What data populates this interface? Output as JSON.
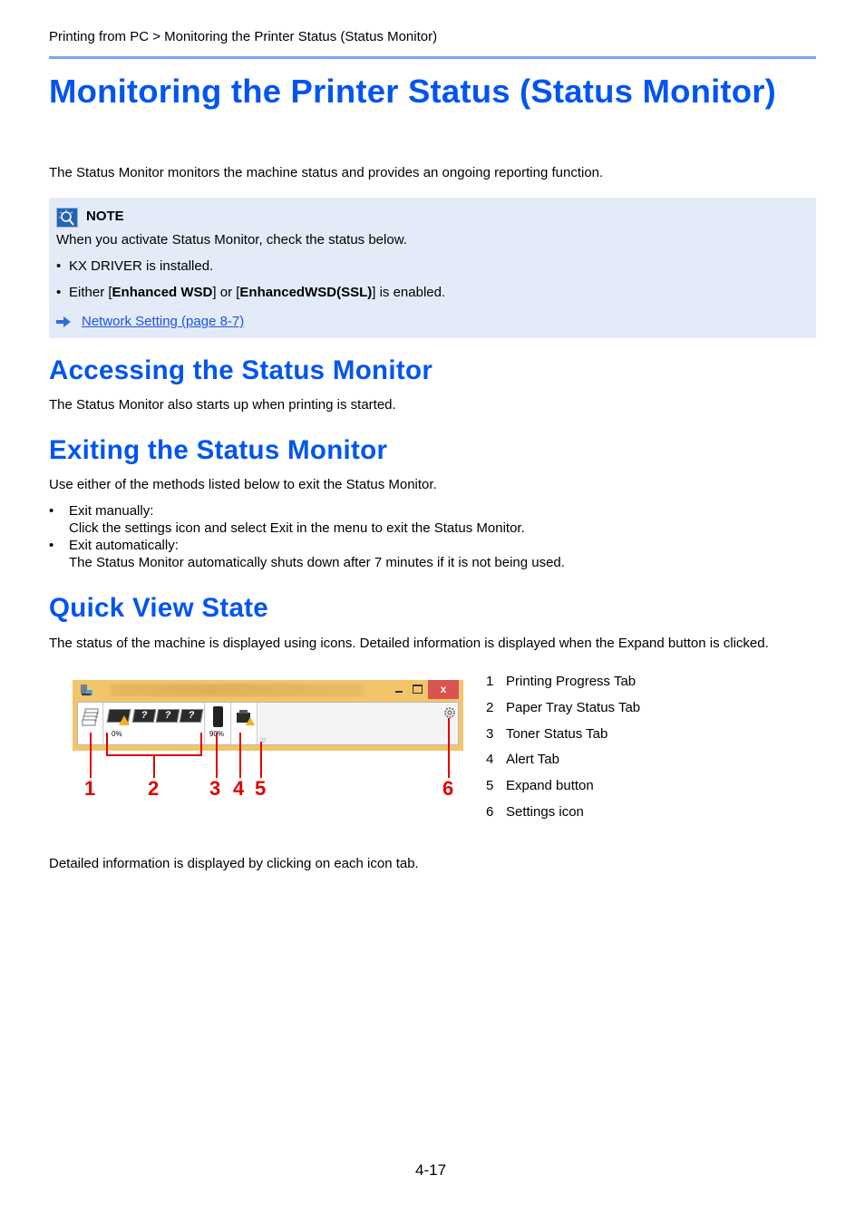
{
  "breadcrumb": "Printing from PC > Monitoring the Printer Status (Status Monitor)",
  "title": "Monitoring the Printer Status (Status Monitor)",
  "intro": "The Status Monitor monitors the machine status and provides an ongoing reporting function.",
  "note": {
    "heading": "NOTE",
    "lead": "When you activate Status Monitor, check the status below.",
    "bullet1": "KX DRIVER is installed.",
    "bullet2": {
      "pre": "Either [",
      "bold1": "Enhanced WSD",
      "mid": "] or [",
      "bold2": "EnhancedWSD(SSL)",
      "post": "] is enabled."
    },
    "link": "Network Setting (page 8-7)"
  },
  "sections": {
    "accessing": {
      "heading": "Accessing the Status Monitor",
      "text": "The Status Monitor also starts up when printing is started."
    },
    "exiting": {
      "heading": "Exiting the Status Monitor",
      "text": "Use either of the methods listed below to exit the Status Monitor.",
      "items": [
        {
          "label": "Exit manually:",
          "detail": "Click the settings icon and select Exit in the menu to exit the Status Monitor."
        },
        {
          "label": "Exit automatically:",
          "detail": "The Status Monitor automatically shuts down after 7 minutes if it is not being used."
        }
      ]
    },
    "quickview": {
      "heading": "Quick View State",
      "text": "The status of the machine is displayed using icons. Detailed information is displayed when the Expand button is clicked.",
      "footer": "Detailed information is displayed by clicking on each icon tab."
    }
  },
  "screenshot": {
    "paper_level": "0%",
    "toner_level": "90%",
    "close_glyph": "x",
    "tray_glyph": "?",
    "callouts": [
      "1",
      "2",
      "3",
      "4",
      "5",
      "6"
    ]
  },
  "legend": [
    {
      "num": "1",
      "label": "Printing Progress Tab"
    },
    {
      "num": "2",
      "label": "Paper Tray Status Tab"
    },
    {
      "num": "3",
      "label": "Toner Status Tab"
    },
    {
      "num": "4",
      "label": "Alert Tab"
    },
    {
      "num": "5",
      "label": "Expand button"
    },
    {
      "num": "6",
      "label": "Settings icon"
    }
  ],
  "page_number": "4-17",
  "colors": {
    "heading": "#0055f0",
    "note_bg": "#e4ebf8",
    "callout": "#e00000",
    "link": "#1a53e6"
  }
}
